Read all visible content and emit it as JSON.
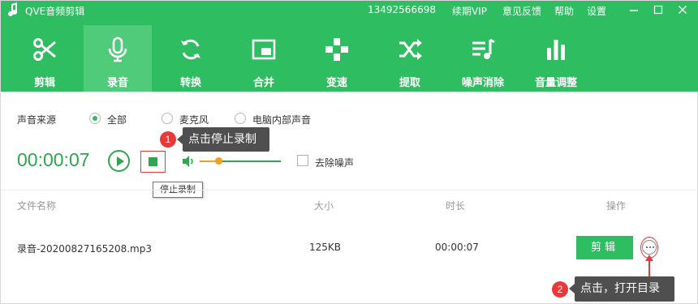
{
  "titlebar": {
    "app_title": "QVE音频剪辑",
    "phone": "13492566698",
    "vip": "续期VIP",
    "feedback": "意见反馈",
    "help": "帮助",
    "settings": "设置",
    "controls": [
      "minimize-icon",
      "maximize-icon",
      "close-icon"
    ]
  },
  "toolbar": {
    "items": [
      {
        "label": "剪辑",
        "icon": "scissors-icon",
        "active": false
      },
      {
        "label": "录音",
        "icon": "microphone-icon",
        "active": true
      },
      {
        "label": "转换",
        "icon": "refresh-icon",
        "active": false
      },
      {
        "label": "合并",
        "icon": "merge-icon",
        "active": false
      },
      {
        "label": "变速",
        "icon": "gamepad-icon",
        "active": false
      },
      {
        "label": "提取",
        "icon": "shuffle-icon",
        "active": false
      },
      {
        "label": "噪声消除",
        "icon": "playlist-icon",
        "active": false
      },
      {
        "label": "音量调整",
        "icon": "bar-chart-icon",
        "active": false
      }
    ]
  },
  "record": {
    "source_label": "声音来源",
    "sources": [
      {
        "label": "全部",
        "checked": true
      },
      {
        "label": "麦克风",
        "checked": false
      },
      {
        "label": "电脑内部声音",
        "checked": false
      }
    ],
    "timer": "00:00:07",
    "volume_level": 0.23,
    "denoise_label": "去除噪声",
    "denoise_checked": false,
    "stop_tooltip": "停止录制"
  },
  "callouts": {
    "one": {
      "number": "1",
      "text": "点击停止录制"
    },
    "two": {
      "number": "2",
      "text": "点击，打开目录"
    }
  },
  "table": {
    "headers": {
      "name": "文件名称",
      "size": "大小",
      "duration": "时长",
      "actions": "操作"
    },
    "rows": [
      {
        "name": "录音-20200827165208.mp3",
        "size": "125KB",
        "duration": "00:00:07",
        "edit_label": "剪辑"
      }
    ]
  },
  "colors": {
    "brand_green": "#2ebd60",
    "active_tab": "#4fcb79",
    "accent_red": "#e8383a",
    "volume_orange": "#f0a020"
  }
}
